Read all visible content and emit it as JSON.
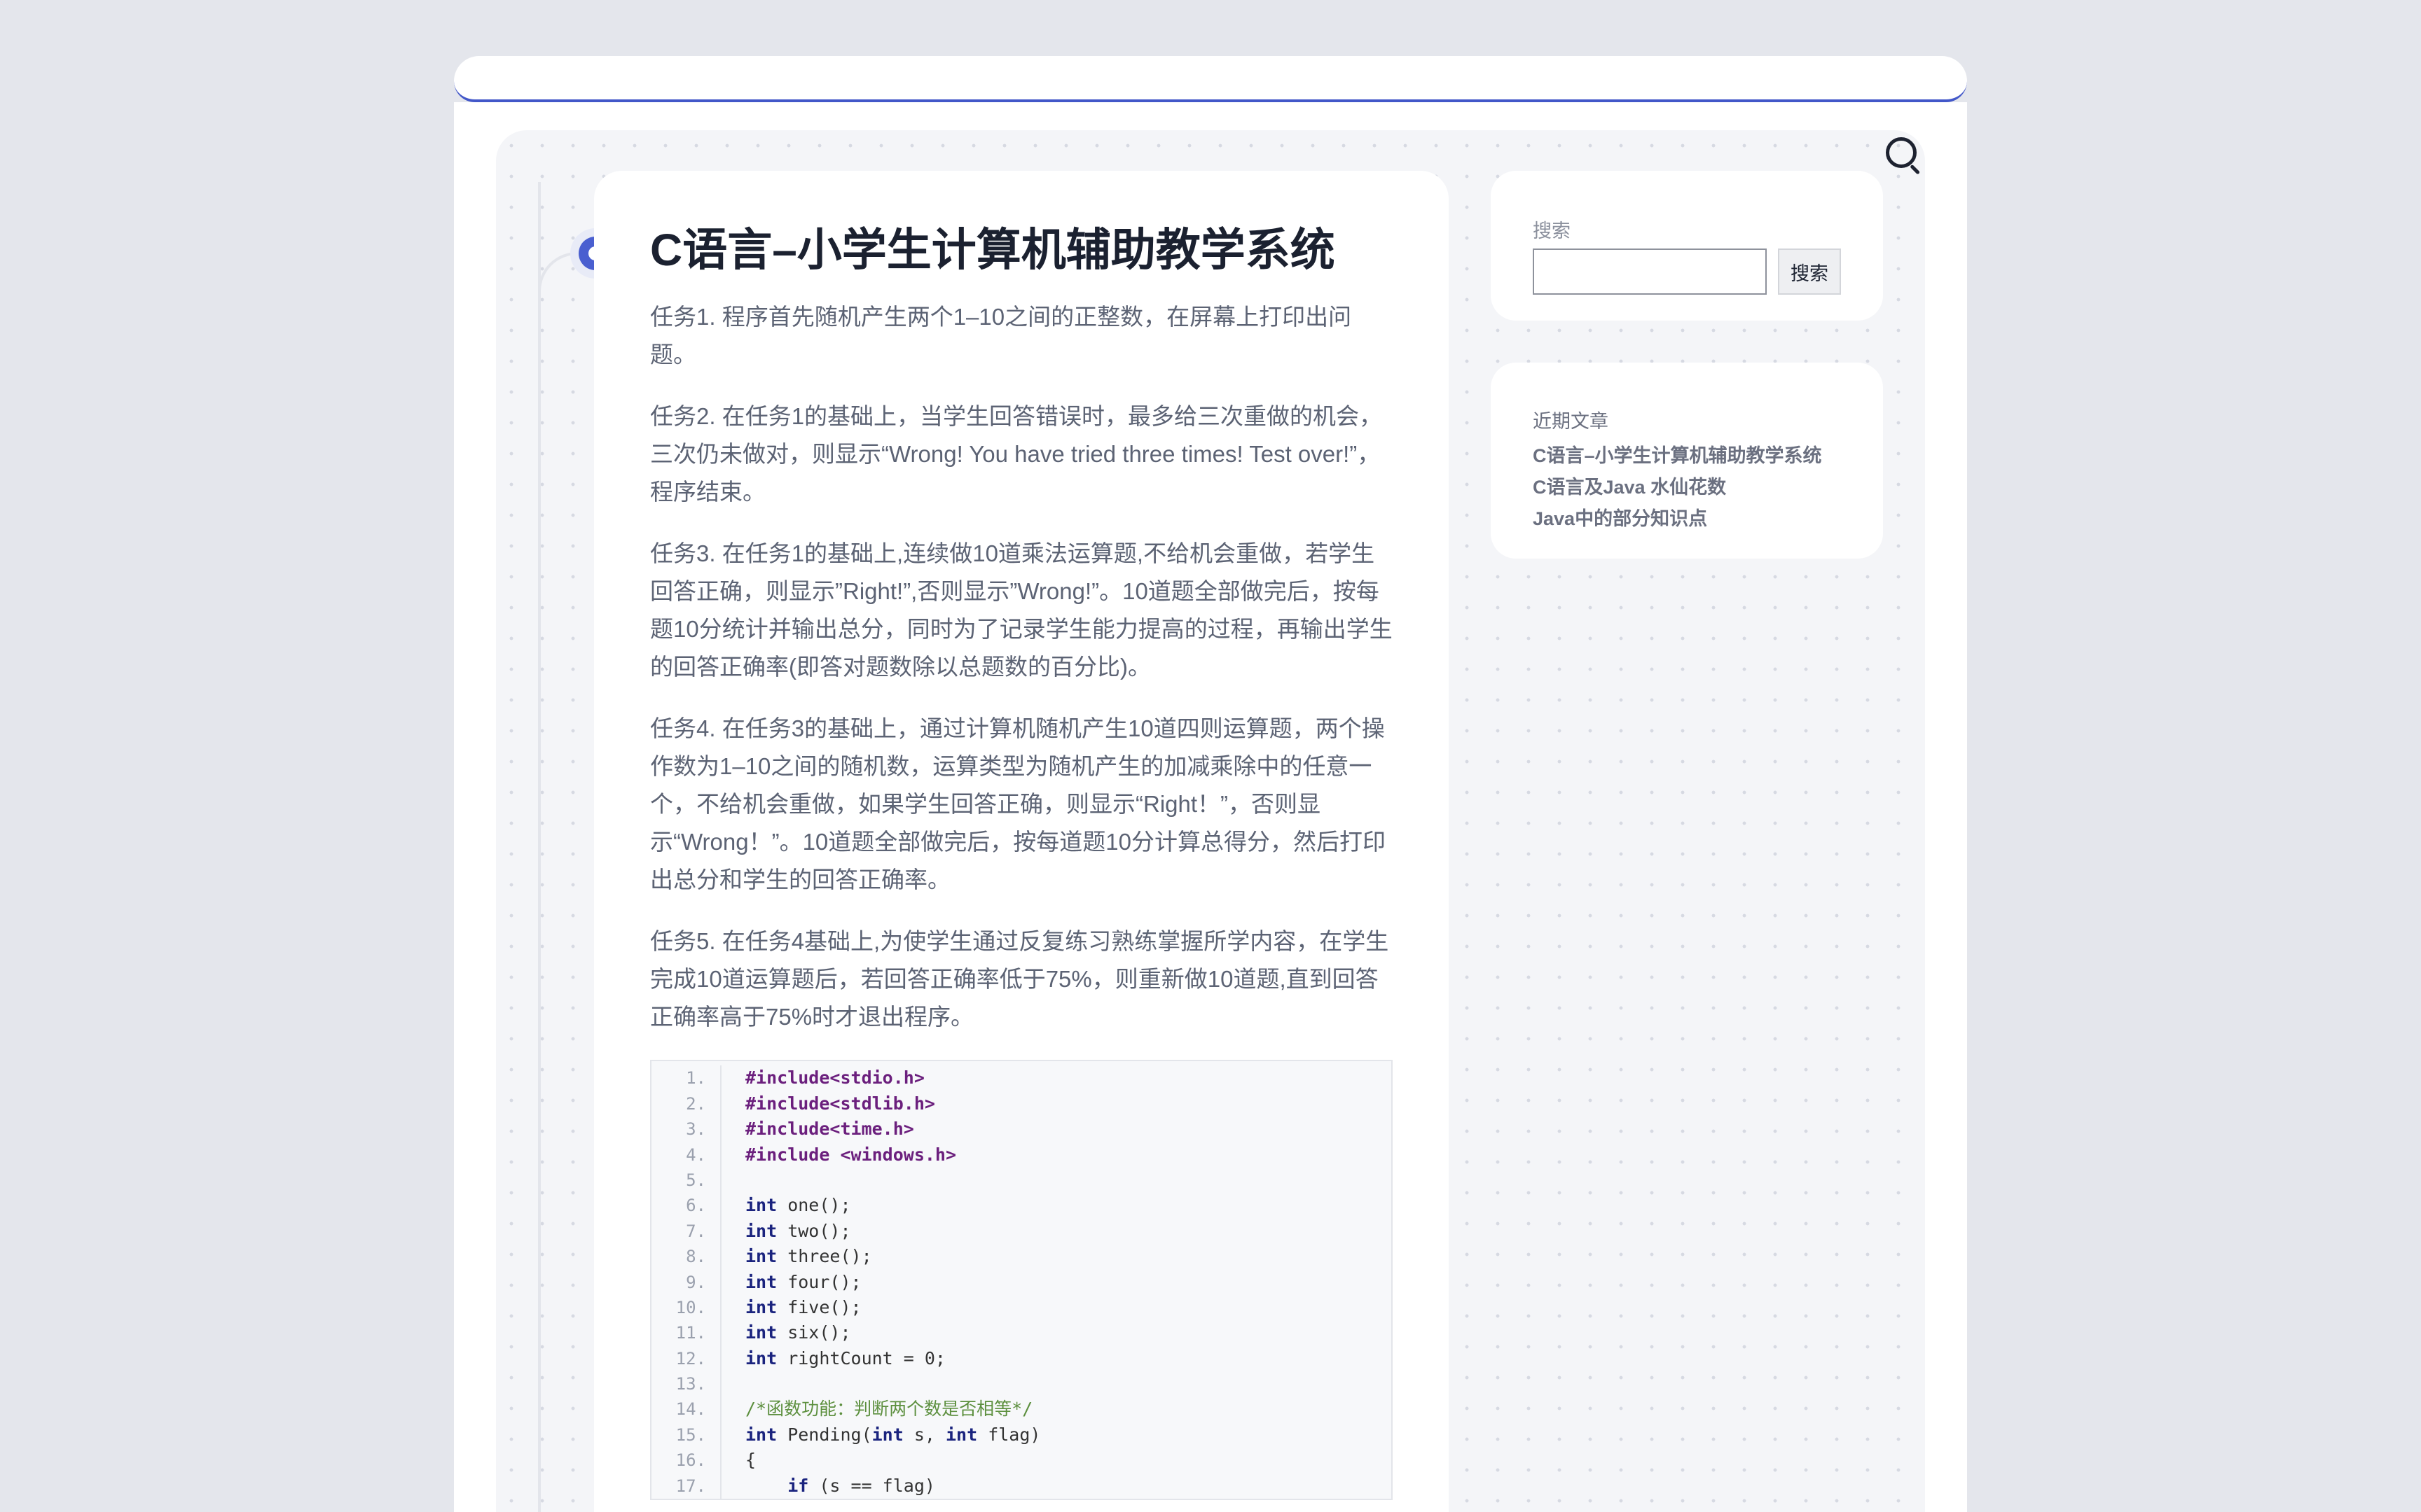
{
  "article": {
    "title": "C语言–小学生计算机辅助教学系统",
    "paragraphs": [
      "任务1. 程序首先随机产生两个1–10之间的正整数，在屏幕上打印出问题。",
      "任务2. 在任务1的基础上，当学生回答错误时，最多给三次重做的机会，三次仍未做对，则显示“Wrong! You have tried three times! Test over!”，程序结束。",
      "任务3. 在任务1的基础上,连续做10道乘法运算题,不给机会重做，若学生回答正确，则显示”Right!”,否则显示”Wrong!”。10道题全部做完后，按每题10分统计并输出总分，同时为了记录学生能力提高的过程，再输出学生的回答正确率(即答对题数除以总题数的百分比)。",
      "任务4. 在任务3的基础上，通过计算机随机产生10道四则运算题，两个操作数为1–10之间的随机数，运算类型为随机产生的加减乘除中的任意一个，不给机会重做，如果学生回答正确，则显示“Right！”，否则显示“Wrong！”。10道题全部做完后，按每道题10分计算总得分，然后打印出总分和学生的回答正确率。",
      "任务5. 在任务4基础上,为使学生通过反复练习熟练掌握所学内容，在学生完成10道运算题后，若回答正确率低于75%，则重新做10道题,直到回答正确率高于75%时才退出程序。"
    ],
    "code": [
      {
        "n": "1.",
        "text": "#include<stdio.h>"
      },
      {
        "n": "2.",
        "text": "#include<stdlib.h>"
      },
      {
        "n": "3.",
        "text": "#include<time.h>"
      },
      {
        "n": "4.",
        "text": "#include <windows.h>"
      },
      {
        "n": "5.",
        "text": ""
      },
      {
        "n": "6.",
        "kw": "int",
        "rest": " one();"
      },
      {
        "n": "7.",
        "kw": "int",
        "rest": " two();"
      },
      {
        "n": "8.",
        "kw": "int",
        "rest": " three();"
      },
      {
        "n": "9.",
        "kw": "int",
        "rest": " four();"
      },
      {
        "n": "10.",
        "kw": "int",
        "rest": " five();"
      },
      {
        "n": "11.",
        "kw": "int",
        "rest": " six();"
      },
      {
        "n": "12.",
        "kw": "int",
        "rest": " rightCount = 0;"
      },
      {
        "n": "13.",
        "text": ""
      },
      {
        "n": "14.",
        "text": "/*函数功能：判断两个数是否相等*/"
      },
      {
        "n": "15.",
        "kw": "int",
        "rest": " Pending(",
        "kw2": "int",
        "rest2": " s, ",
        "kw3": "int",
        "rest3": " flag)"
      },
      {
        "n": "16.",
        "text": "{"
      },
      {
        "n": "17.",
        "indent": "    ",
        "kw": "if",
        "rest": " (s == flag)"
      }
    ]
  },
  "sidebar": {
    "search": {
      "label": "搜索",
      "button_label": "搜索",
      "placeholder": ""
    },
    "recent": {
      "heading": "近期文章",
      "posts": [
        "C语言–小学生计算机辅助教学系统",
        "C语言及Java 水仙花数",
        "Java中的部分知识点"
      ]
    }
  },
  "colors": {
    "accent": "#4a5fd0",
    "background": "#e4e6ec",
    "text": "#5c6374",
    "heading": "#1b2130"
  }
}
